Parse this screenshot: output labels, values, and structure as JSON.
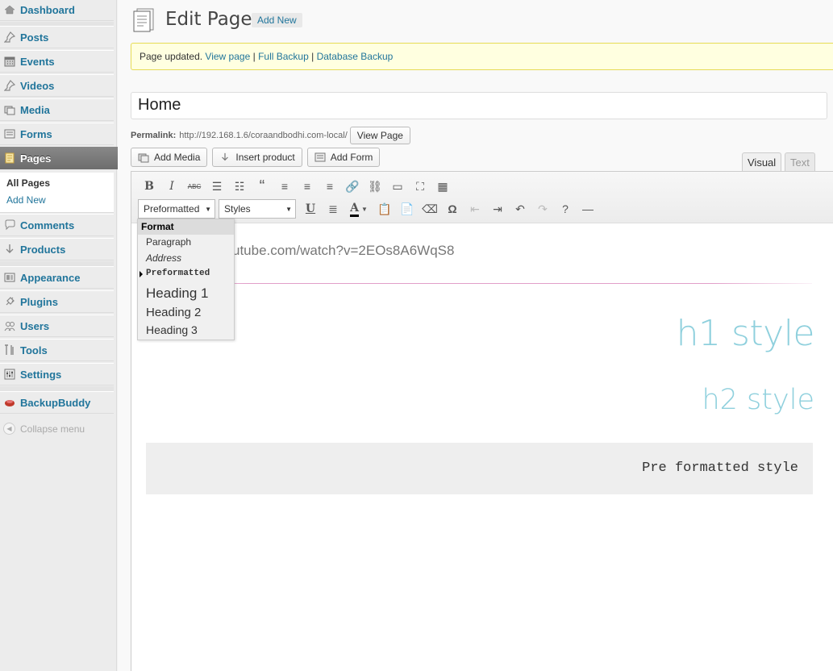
{
  "sidebar": {
    "items": [
      {
        "label": "Dashboard",
        "icon": "dashboard-icon"
      },
      {
        "label": "Posts",
        "icon": "pushpin-icon"
      },
      {
        "label": "Events",
        "icon": "calendar-icon"
      },
      {
        "label": "Videos",
        "icon": "pushpin-icon"
      },
      {
        "label": "Media",
        "icon": "media-icon"
      },
      {
        "label": "Forms",
        "icon": "forms-icon"
      },
      {
        "label": "Pages",
        "icon": "pages-icon",
        "active": true
      },
      {
        "label": "Comments",
        "icon": "comment-icon"
      },
      {
        "label": "Products",
        "icon": "download-arrow-icon"
      },
      {
        "label": "Appearance",
        "icon": "appearance-icon"
      },
      {
        "label": "Plugins",
        "icon": "plug-icon"
      },
      {
        "label": "Users",
        "icon": "users-icon"
      },
      {
        "label": "Tools",
        "icon": "tools-icon"
      },
      {
        "label": "Settings",
        "icon": "settings-icon"
      },
      {
        "label": "BackupBuddy",
        "icon": "backupbuddy-icon"
      }
    ],
    "submenu": [
      "All Pages",
      "Add New"
    ],
    "collapse_label": "Collapse menu"
  },
  "header": {
    "title": "Edit Page",
    "add_new": "Add New"
  },
  "notice": {
    "text": "Page updated.",
    "link_view": "View page",
    "sep": "|",
    "link_full_backup": "Full Backup",
    "link_db_backup": "Database Backup"
  },
  "post_title": "Home",
  "permalink": {
    "label": "Permalink:",
    "url": "http://192.168.1.6/coraandbodhi.com-local/",
    "button": "View Page"
  },
  "media_buttons": {
    "add_media": "Add Media",
    "insert_product": "Insert product",
    "add_form": "Add Form"
  },
  "editor_tabs": {
    "visual": "Visual",
    "text": "Text"
  },
  "toolbar": {
    "format_select": "Preformatted",
    "styles_select": "Styles"
  },
  "format_dropdown": {
    "header": "Format",
    "options": [
      "Paragraph",
      "Address",
      "Preformatted",
      "Heading 1",
      "Heading 2",
      "Heading 3"
    ],
    "selected": "Preformatted"
  },
  "content": {
    "youtube_url": "utube.com/watch?v=2EOs8A6WqS8",
    "h1": "h1 style",
    "h2": "h2 style",
    "pre": "Pre formatted style"
  },
  "colors": {
    "link": "#21759b",
    "accent_heading": "#8fd0dd",
    "notice_bg": "#ffffe0"
  }
}
